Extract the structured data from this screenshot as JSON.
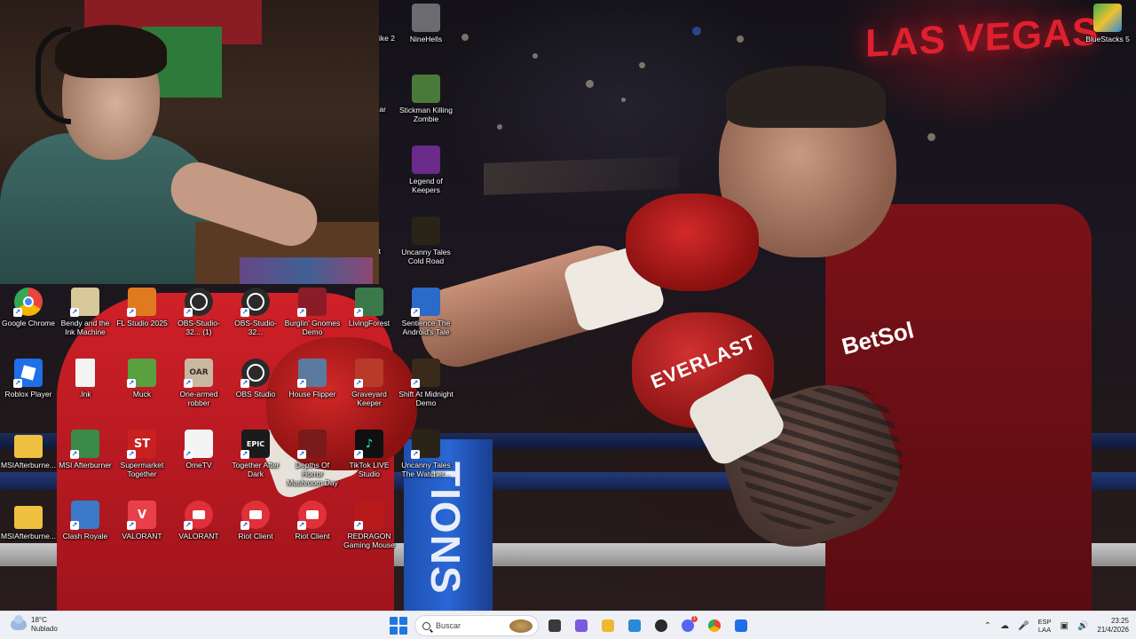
{
  "wallpaper": {
    "sign_text": "LAS VEGAS",
    "post_text": "TIONS",
    "glove_brand": "EVERLAST",
    "jersey_text": "BetSol"
  },
  "desktop": {
    "partial_labels": [
      "rike 2",
      "ear",
      "t"
    ],
    "icons": [
      {
        "label": "NineHells",
        "icon": "ninehells-icon",
        "color": "#6b6b70"
      },
      {
        "label": "Stickman Killing Zombie",
        "icon": "stickman-icon",
        "color": "#4a7a3a"
      },
      {
        "label": "Legend of Keepers",
        "icon": "legend-of-keepers-icon",
        "color": "#6a2a8a"
      },
      {
        "label": "Uncanny Tales Cold Road",
        "icon": "uncanny-tales-icon",
        "color": "#2a2418"
      },
      {
        "label": "BlueStacks 5",
        "icon": "bluestacks-icon",
        "color": "#3ab04a"
      },
      {
        "label": "Google Chrome",
        "icon": "chrome-icon",
        "color": "#e8453c"
      },
      {
        "label": "Bendy and the Ink Machine",
        "icon": "bendy-icon",
        "color": "#d8c89a"
      },
      {
        "label": "FL Studio 2025",
        "icon": "fl-studio-icon",
        "color": "#e07a20"
      },
      {
        "label": "OBS-Studio-32... (1)",
        "icon": "obs-icon",
        "color": "#2a2a2a"
      },
      {
        "label": "OBS-Studio-32...",
        "icon": "obs-icon",
        "color": "#2a2a2a"
      },
      {
        "label": "Burglin' Gnomes Demo",
        "icon": "burglin-gnomes-icon",
        "color": "#8a1c28"
      },
      {
        "label": "LivingForest",
        "icon": "living-forest-icon",
        "color": "#3a7a4a"
      },
      {
        "label": "Sentience The Android's Tale",
        "icon": "sentience-icon",
        "color": "#2a6ac8"
      },
      {
        "label": "Roblox Player",
        "icon": "roblox-icon",
        "color": "#1e6fe8"
      },
      {
        "label": ".lnk",
        "icon": "file-icon",
        "color": "#f4f4f4"
      },
      {
        "label": "Muck",
        "icon": "muck-icon",
        "color": "#5aa040"
      },
      {
        "label": "One-armed robber",
        "icon": "one-armed-robber-icon",
        "color": "#c8b8a0"
      },
      {
        "label": "OBS Studio",
        "icon": "obs-icon",
        "color": "#2a2a2a"
      },
      {
        "label": "House Flipper",
        "icon": "house-flipper-icon",
        "color": "#5a7aa0"
      },
      {
        "label": "Graveyard Keeper",
        "icon": "graveyard-keeper-icon",
        "color": "#b83a28"
      },
      {
        "label": "Shift At Midnight Demo",
        "icon": "shift-at-midnight-icon",
        "color": "#3a2a1a"
      },
      {
        "label": "MSIAfterburne...",
        "icon": "folder-icon",
        "color": "#f0c040"
      },
      {
        "label": "MSI Afterburner",
        "icon": "msi-afterburner-icon",
        "color": "#3a8a4a"
      },
      {
        "label": "Supermarket Together",
        "icon": "supermarket-together-icon",
        "color": "#c82020"
      },
      {
        "label": "OmeTV",
        "icon": "ometv-icon",
        "color": "#f4f4f4"
      },
      {
        "label": "Together After Dark",
        "icon": "epic-games-icon",
        "color": "#1a1a1a"
      },
      {
        "label": "Depths Of Horror Mushroom Day",
        "icon": "depths-of-horror-icon",
        "color": "#7a1a1a"
      },
      {
        "label": "TikTok LIVE Studio",
        "icon": "tiktok-icon",
        "color": "#101010"
      },
      {
        "label": "Uncanny Tales The Watcher...",
        "icon": "uncanny-tales-watcher-icon",
        "color": "#2a2418"
      },
      {
        "label": "MSIAfterburne...",
        "icon": "folder-icon",
        "color": "#f0c040"
      },
      {
        "label": "Clash Royale",
        "icon": "clash-royale-icon",
        "color": "#3a7ac8"
      },
      {
        "label": "VALORANT",
        "icon": "valorant-icon",
        "color": "#e8404a"
      },
      {
        "label": "VALORANT",
        "icon": "riot-client-icon",
        "color": "#e0303a"
      },
      {
        "label": "Riot Client",
        "icon": "riot-client-icon",
        "color": "#e0303a"
      },
      {
        "label": "Riot Client",
        "icon": "riot-client-icon",
        "color": "#e0303a"
      },
      {
        "label": "REDRAGON Gaming Mouse",
        "icon": "redragon-icon",
        "color": "#b81a1a"
      }
    ]
  },
  "taskbar": {
    "weather": {
      "temp": "18°C",
      "condition": "Nublado"
    },
    "search_placeholder": "Buscar",
    "apps": [
      {
        "name": "file-explorer",
        "icon": "terminal-icon",
        "color": "#3a3a3a",
        "badge": ""
      },
      {
        "name": "copilot",
        "icon": "copilot-icon",
        "color": "#7a5ae0",
        "badge": ""
      },
      {
        "name": "folder",
        "icon": "folder-icon",
        "color": "#f0b830",
        "badge": ""
      },
      {
        "name": "store",
        "icon": "store-icon",
        "color": "#2a8ad8",
        "badge": ""
      },
      {
        "name": "obs",
        "icon": "obs-icon",
        "color": "#2a2a2a",
        "badge": ""
      },
      {
        "name": "discord",
        "icon": "discord-icon",
        "color": "#5865f2",
        "badge": "1"
      },
      {
        "name": "chrome",
        "icon": "chrome-icon",
        "color": "#e8453c",
        "badge": ""
      },
      {
        "name": "riot-vanguard",
        "icon": "shield-icon",
        "color": "#1e6fe8",
        "badge": ""
      }
    ],
    "tray": {
      "lang_top": "ESP",
      "lang_bottom": "LAA",
      "time": "23:25",
      "date": "21/4/2026"
    }
  }
}
